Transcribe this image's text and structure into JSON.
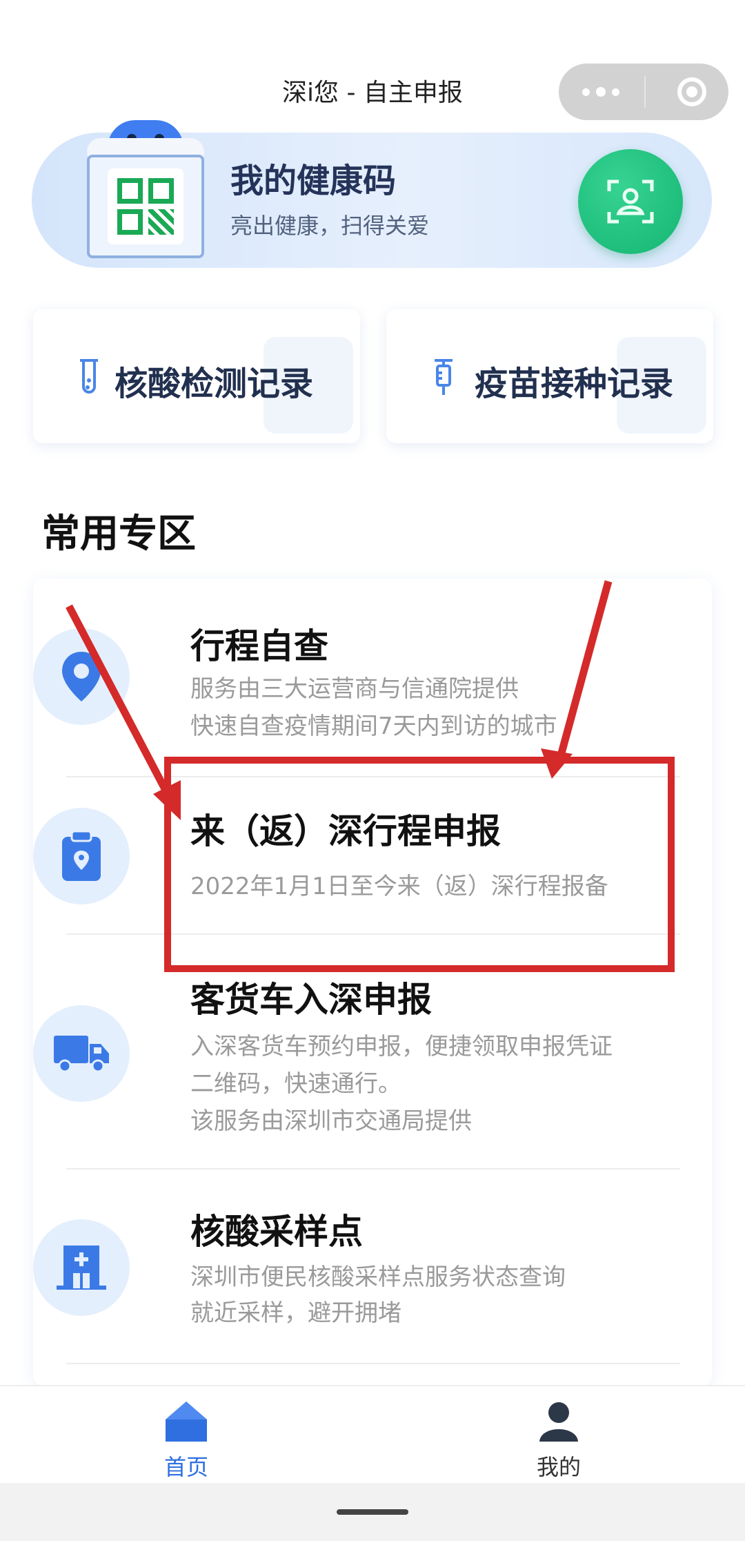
{
  "header": {
    "title": "深i您 - 自主申报",
    "more_icon": "more-dots-icon",
    "close_icon": "target-circle-icon"
  },
  "health_code": {
    "title": "我的健康码",
    "subtitle": "亮出健康，扫得关爱",
    "scan_icon": "face-scan-icon",
    "accent": "#1db875"
  },
  "records": [
    {
      "label": "核酸检测记录",
      "icon": "test-tube-icon"
    },
    {
      "label": "疫苗接种记录",
      "icon": "syringe-icon"
    }
  ],
  "section": {
    "title": "常用专区"
  },
  "services": [
    {
      "name": "行程自查",
      "lines": [
        "服务由三大运营商与信通院提供",
        "快速自查疫情期间7天内到访的城市"
      ],
      "icon": "location-pin-icon"
    },
    {
      "name": "来（返）深行程申报",
      "lines": [
        "2022年1月1日至今来（返）深行程报备"
      ],
      "icon": "clipboard-location-icon"
    },
    {
      "name": "客货车入深申报",
      "lines": [
        "入深客货车预约申报，便捷领取申报凭证",
        "二维码，快速通行。",
        "该服务由深圳市交通局提供"
      ],
      "icon": "truck-icon"
    },
    {
      "name": "核酸采样点",
      "lines": [
        "深圳市便民核酸采样点服务状态查询",
        "就近采样，避开拥堵"
      ],
      "icon": "hospital-icon"
    }
  ],
  "annotation": {
    "color": "#d42a2a",
    "target": "来（返）深行程申报"
  },
  "tabbar": {
    "home_label": "首页",
    "mine_label": "我的",
    "active_color": "#2f6fe0"
  }
}
